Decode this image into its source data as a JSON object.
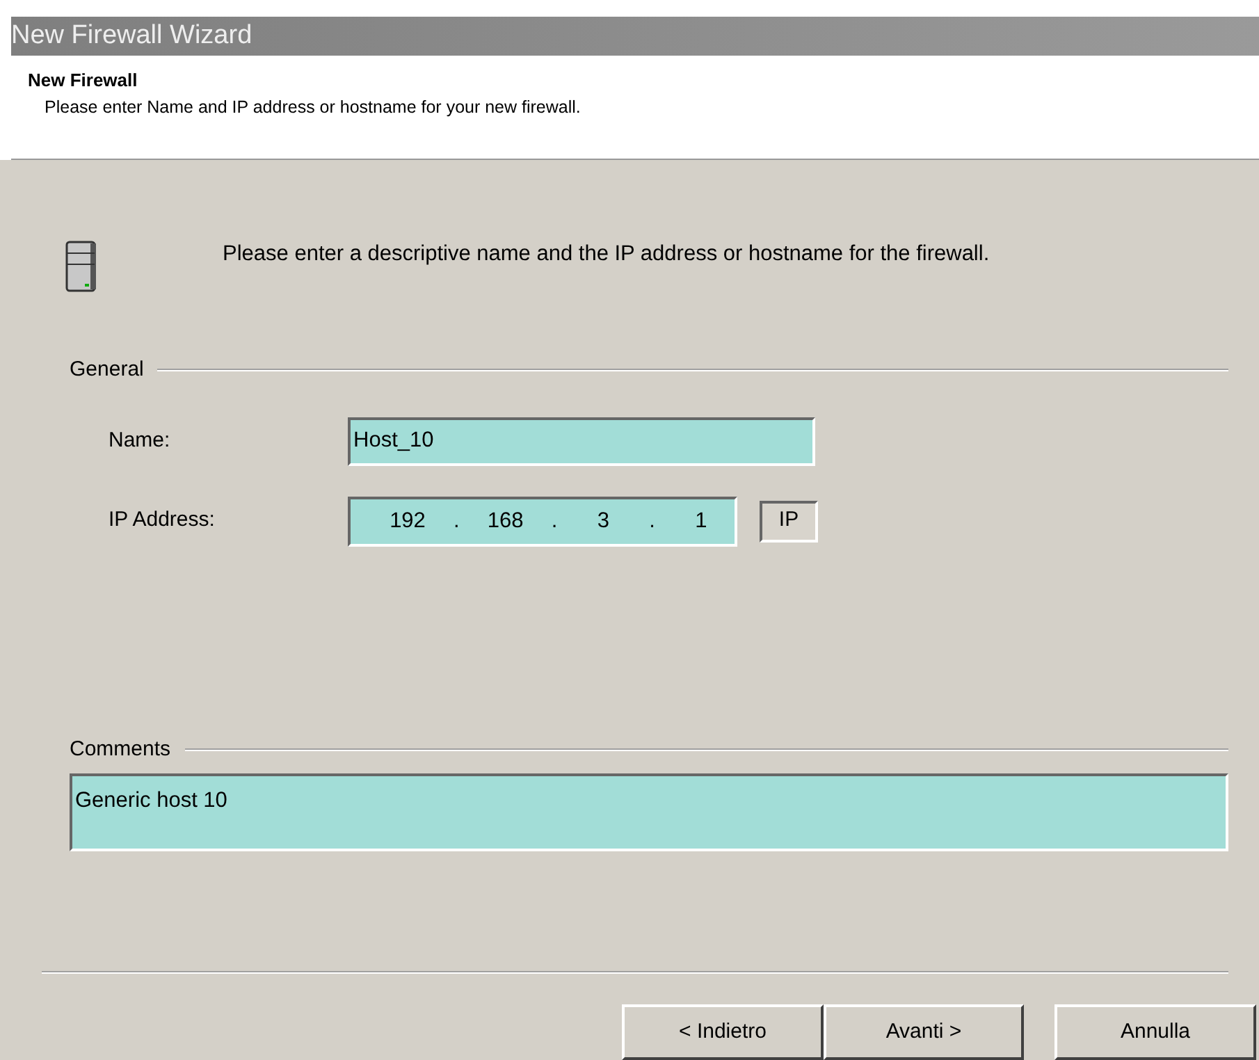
{
  "window": {
    "title": "New Firewall Wizard"
  },
  "header": {
    "title": "New Firewall",
    "subtitle": "Please enter Name and IP address or hostname for your new firewall."
  },
  "intro": "Please enter a descriptive name and the IP address or hostname for the firewall.",
  "general": {
    "legend": "General",
    "name": {
      "label": "Name:",
      "value": "Host_10"
    },
    "ip_address": {
      "label": "IP Address:",
      "parts": [
        {
          "kind": "octet",
          "text": "192"
        },
        {
          "kind": "dot",
          "text": "."
        },
        {
          "kind": "octet",
          "text": "168"
        },
        {
          "kind": "dot",
          "text": "."
        },
        {
          "kind": "octet",
          "text": "3"
        },
        {
          "kind": "dot",
          "text": "."
        },
        {
          "kind": "octet",
          "text": "1"
        }
      ],
      "button": "IP"
    }
  },
  "comments": {
    "legend": "Comments",
    "value": "Generic host 10"
  },
  "buttons": [
    "< Indietro",
    "Avanti >",
    "Annulla"
  ]
}
